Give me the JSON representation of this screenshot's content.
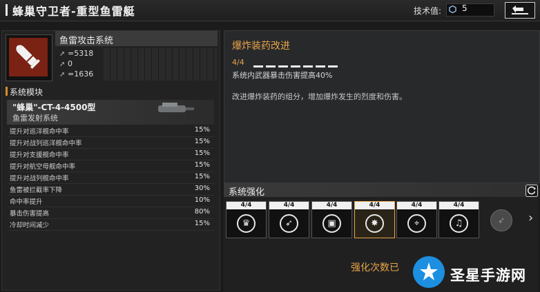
{
  "header": {
    "title": "蜂巢守卫者-重型鱼雷艇",
    "tech_label": "技术值:",
    "tech_value": "5"
  },
  "weapon": {
    "name": "鱼雷攻击系统",
    "stats": [
      {
        "icon": "damage-icon",
        "value": "=5318"
      },
      {
        "icon": "speed-icon",
        "value": "0"
      },
      {
        "icon": "range-icon",
        "value": "=1636"
      }
    ]
  },
  "modules": {
    "section_title": "系统模块",
    "name": "\"蜂巢\"-CT-4-4500型",
    "subtitle": "鱼雷发射系统",
    "rows": [
      {
        "label": "提升对巡洋舰命中率",
        "value": "15%"
      },
      {
        "label": "提升对战列巡洋舰命中率",
        "value": "15%"
      },
      {
        "label": "提升对支援舰命中率",
        "value": "15%"
      },
      {
        "label": "提升对航空母舰命中率",
        "value": "15%"
      },
      {
        "label": "提升对战列舰命中率",
        "value": "15%"
      },
      {
        "label": "鱼雷被拦截率下降",
        "value": "30%"
      },
      {
        "label": "命中率提升",
        "value": "10%"
      },
      {
        "label": "暴击伤害提高",
        "value": "80%"
      },
      {
        "label": "冷却时间减少",
        "value": "15%"
      }
    ]
  },
  "upgrade": {
    "title": "爆炸装药改进",
    "level": "4/4",
    "level_fraction": 1.0,
    "effect": "系统内武器暴击伤害提高40%",
    "description": "改进爆炸装药的组分，增加爆炸发生的烈度和伤害。"
  },
  "enhancement": {
    "title": "系统强化",
    "nodes": [
      {
        "level": "4/4",
        "icon": "lion-emblem-icon",
        "glyph": "♛"
      },
      {
        "level": "4/4",
        "icon": "missile-icon",
        "glyph": "➶"
      },
      {
        "level": "4/4",
        "icon": "chip-icon",
        "glyph": "▣"
      },
      {
        "level": "4/4",
        "icon": "explosion-icon",
        "glyph": "✸"
      },
      {
        "level": "4/4",
        "icon": "targeting-icon",
        "glyph": "⌖"
      },
      {
        "level": "4/4",
        "icon": "guitar-icon",
        "glyph": "♫"
      }
    ],
    "selected_index": 3,
    "count_label": "强化次数已"
  },
  "watermark": {
    "text": "圣星手游网"
  },
  "colors": {
    "accent": "#e9a54a",
    "weapon_bg": "#7a2214",
    "watermark": "#1d8fe0"
  }
}
